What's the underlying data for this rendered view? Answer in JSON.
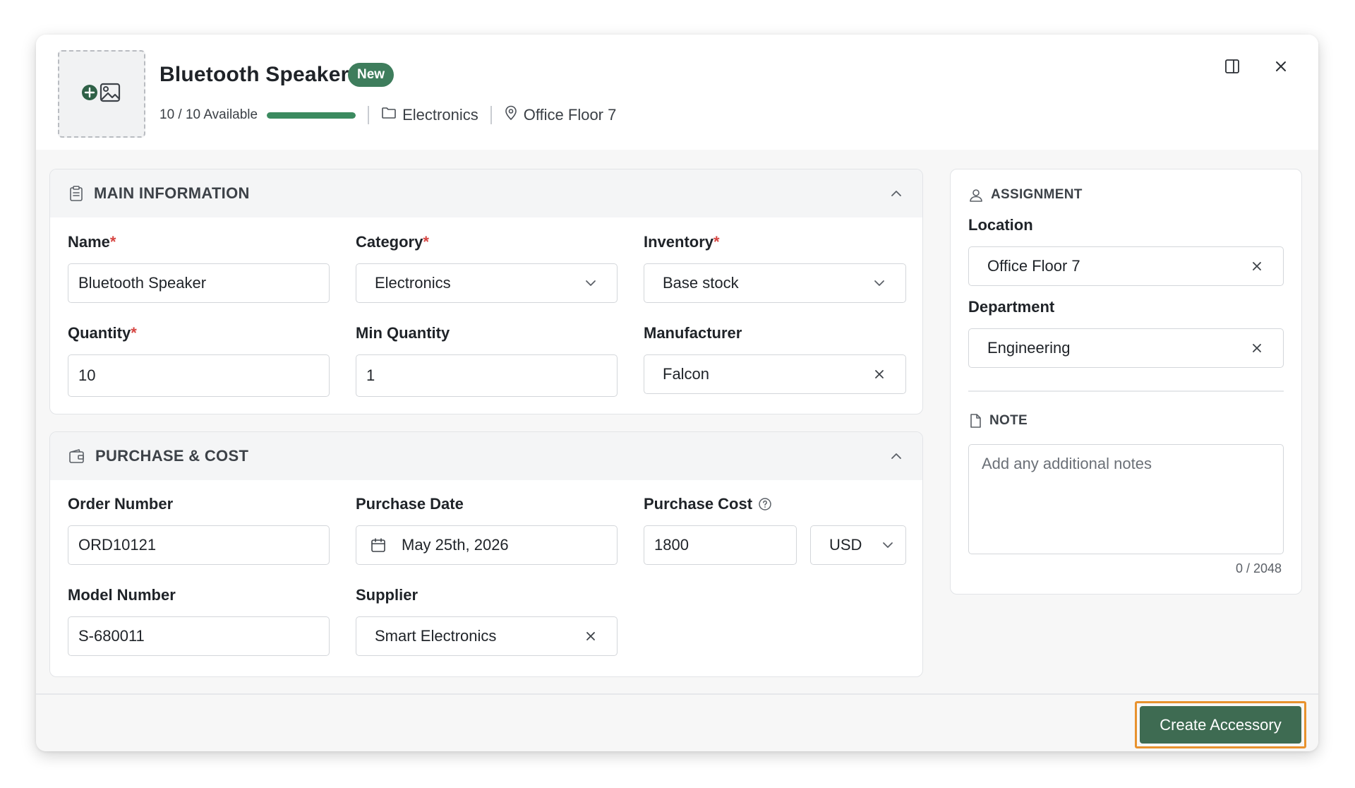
{
  "header": {
    "title": "Bluetooth Speaker",
    "badge": "New",
    "availability": "10 / 10 Available",
    "availability_fraction": 1.0,
    "category": "Electronics",
    "location": "Office Floor 7",
    "icons": {
      "image_placeholder": "add-image-icon",
      "category": "folder-icon",
      "location": "map-pin-icon",
      "panel": "split-panel-icon",
      "close": "close-icon"
    }
  },
  "main_info": {
    "title": "MAIN INFORMATION",
    "name": {
      "label": "Name",
      "value": "Bluetooth Speaker"
    },
    "category": {
      "label": "Category",
      "value": "Electronics"
    },
    "inventory": {
      "label": "Inventory",
      "value": "Base stock"
    },
    "quantity": {
      "label": "Quantity",
      "value": "10"
    },
    "min_quantity": {
      "label": "Min Quantity",
      "value": "1"
    },
    "manufacturer": {
      "label": "Manufacturer",
      "value": "Falcon"
    },
    "required_marker": "*"
  },
  "purchase": {
    "title": "PURCHASE & COST",
    "order_number": {
      "label": "Order Number",
      "value": "ORD10121"
    },
    "purchase_date": {
      "label": "Purchase Date",
      "value": "May 25th, 2026"
    },
    "purchase_cost": {
      "label": "Purchase Cost",
      "value": "1800",
      "currency": "USD"
    },
    "model_number": {
      "label": "Model Number",
      "value": "S-680011"
    },
    "supplier": {
      "label": "Supplier",
      "value": "Smart Electronics"
    }
  },
  "assignment": {
    "title": "ASSIGNMENT",
    "location": {
      "label": "Location",
      "value": "Office Floor 7"
    },
    "department": {
      "label": "Department",
      "value": "Engineering"
    }
  },
  "note": {
    "title": "NOTE",
    "placeholder": "Add any additional notes",
    "counter": "0 / 2048"
  },
  "footer": {
    "create_label": "Create Accessory"
  },
  "colors": {
    "accent": "#3e6b52",
    "badge": "#3e7d5c",
    "progress": "#3b8a5f",
    "required": "#d64541",
    "focus_outline": "#e8922e"
  }
}
